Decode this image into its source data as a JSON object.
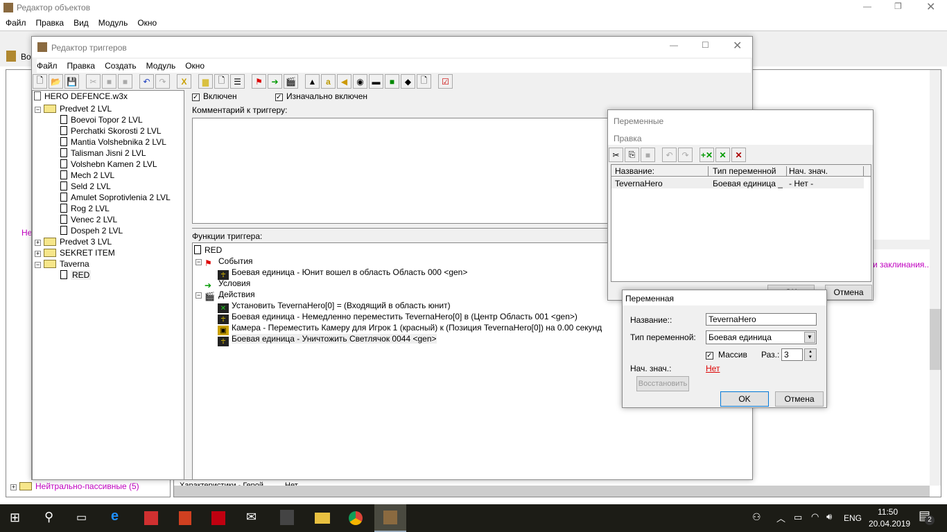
{
  "main": {
    "title": "Редактор объектов",
    "menu": [
      "Файл",
      "Правка",
      "Вид",
      "Модуль",
      "Окно"
    ],
    "tab_label": "Bo",
    "tree_bottom_label": "Нейтрально-пассивные (5)",
    "tree_partial_label": "Не",
    "right_magenta_text": "и заклинания...",
    "status_row": [
      "Характеристики - Герой",
      "Нет"
    ]
  },
  "trigger_editor": {
    "title": "Редактор триггеров",
    "menu": [
      "Файл",
      "Правка",
      "Создать",
      "Модуль",
      "Окно"
    ],
    "tree": {
      "root": "HERO DEFENCE.w3x",
      "folder1": "Predvet 2 LVL",
      "items": [
        "Boevoi Topor 2 LVL",
        "Perchatki Skorosti 2 LVL",
        "Mantia Volshebnika 2 LVL",
        "Talisman Jisni 2 LVL",
        "Volshebn Kamen 2 LVL",
        "Mech 2 LVL",
        "Seld 2 LVL",
        "Amulet Soprotivlenia 2 LVL",
        "Rog 2 LVL",
        "Venec 2 LVL",
        "Dospeh 2 LVL"
      ],
      "folder2": "Predvet 3 LVL",
      "folder3": "SEKRET ITEM",
      "folder4": "Taverna",
      "selected": "RED"
    },
    "enabled_label": "Включен",
    "initially_enabled_label": "Изначально включен",
    "comment_label": "Комментарий к триггеру:",
    "functions_label": "Функции триггера:",
    "functions": {
      "name": "RED",
      "events_label": "События",
      "event1": "Боевая единица - Юнит вошел в область Область 000 <gen>",
      "conditions_label": "Условия",
      "actions_label": "Действия",
      "actions": [
        "Установить TevernaHero[0] = (Входящий в область юнит)",
        "Боевая единица - Немедленно переместить TevernaHero[0] в (Центр Область 001 <gen>)",
        "Камера - Переместить Камеру для Игрок 1 (красный) к (Позиция TevernaHero[0]) на 0.00 секунд",
        "Боевая единица - Уничтожить Светлячок 0044 <gen>"
      ]
    }
  },
  "variables": {
    "title": "Переменные",
    "menu": "Правка",
    "columns": [
      "Название:",
      "Тип переменной",
      "Нач. знач."
    ],
    "row": [
      "TevernaHero",
      "Боевая единица _",
      "- Нет -"
    ],
    "ok": "OK",
    "cancel": "Отмена"
  },
  "variable_dialog": {
    "title": "Переменная",
    "name_label": "Название::",
    "name_value": "TevernaHero",
    "type_label": "Тип переменной:",
    "type_value": "Боевая единица",
    "array_label": "Массив",
    "array_checked": true,
    "size_label": "Раз.:",
    "size_value": "3",
    "init_label": "Нач. знач.:",
    "init_value": "Нет",
    "restore": "Восстановить",
    "ok": "OK",
    "cancel": "Отмена"
  },
  "taskbar": {
    "lang": "ENG",
    "time": "11:50",
    "date": "20.04.2019",
    "notifications": "2"
  }
}
